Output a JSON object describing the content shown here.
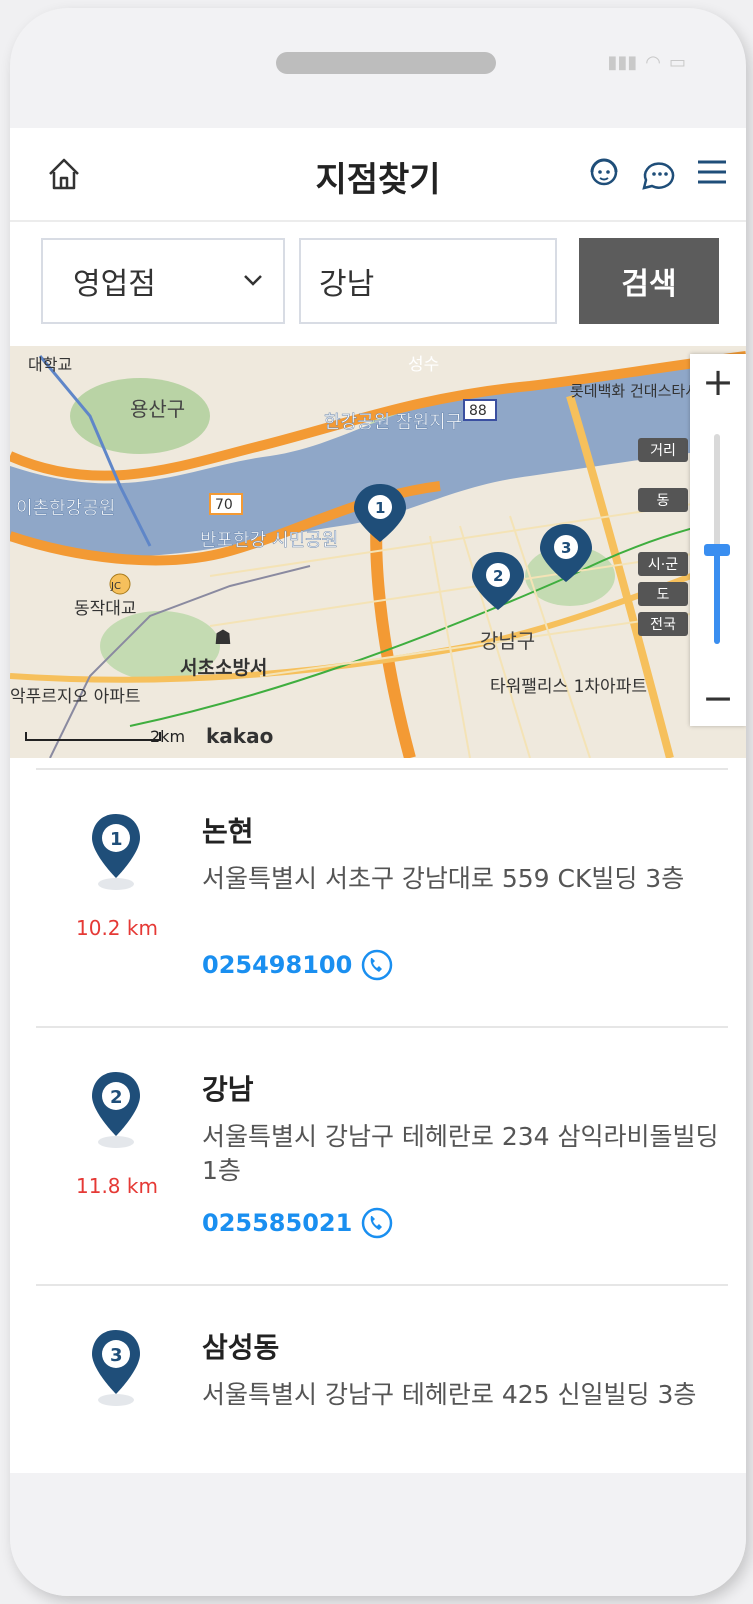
{
  "header": {
    "title": "지점찾기"
  },
  "search": {
    "select_value": "영업점",
    "input_value": "강남",
    "button_label": "검색"
  },
  "map": {
    "zoom_in": "+",
    "zoom_out": "−",
    "levels": [
      "거리",
      "동",
      "시·군",
      "도",
      "전국"
    ],
    "scale_label": "2km",
    "logo": "kakao",
    "labels": [
      "용산구",
      "한강공원 잠원지구",
      "이촌한강공원",
      "반포한강 시민공원",
      "동작대교",
      "서초소방서",
      "강남구",
      "타워팰리스 1차아파트",
      "성수",
      "롯데백화 건대스타시",
      "악푸르지오 아파트",
      "대학교",
      "70",
      "88",
      "JC"
    ]
  },
  "branches": [
    {
      "index": "1",
      "name": "논현",
      "address": "서울특별시 서초구 강남대로 559 CK빌딩 3층",
      "distance": "10.2 km",
      "phone": "025498100"
    },
    {
      "index": "2",
      "name": "강남",
      "address": "서울특별시 강남구 테헤란로 234 삼익라비돌빌딩 1층",
      "distance": "11.8 km",
      "phone": "025585021"
    },
    {
      "index": "3",
      "name": "삼성동",
      "address": "서울특별시 강남구 테헤란로 425 신일빌딩 3층",
      "distance": "",
      "phone": ""
    }
  ],
  "colors": {
    "marker": "#1f4e79",
    "distance": "#e53935",
    "phone": "#1a8ff0",
    "button": "#5c5c5c",
    "map_river": "#8fa7c8",
    "map_road": "#f39a34",
    "zoom_fill": "#3a8ef0"
  }
}
